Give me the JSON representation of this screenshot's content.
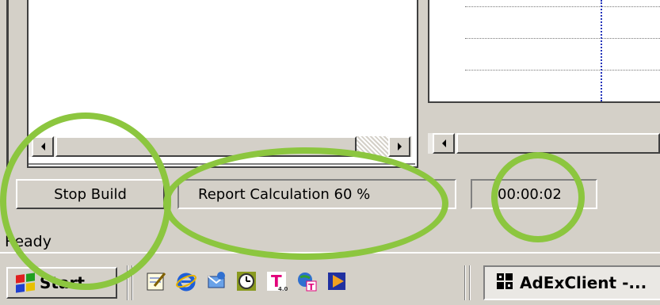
{
  "status": {
    "stop_build_label": "Stop Build",
    "report_text": "Report Calculation  60 %",
    "progress_percent": 60,
    "elapsed_time": "00:00:02",
    "ready_text": "Ready"
  },
  "taskbar": {
    "start_label": "Start",
    "quick_launch": [
      {
        "name": "notepad-icon"
      },
      {
        "name": "internet-explorer-icon"
      },
      {
        "name": "outlook-icon"
      },
      {
        "name": "clock-icon"
      },
      {
        "name": "t-online-icon",
        "glyph": "T"
      },
      {
        "name": "globe-t-icon"
      },
      {
        "name": "media-player-icon"
      }
    ],
    "active_task_label": "AdExClient -..."
  },
  "colors": {
    "annotation": "#8cc63f",
    "grid_vertical": "#2233bb",
    "face": "#d4d0c8"
  }
}
